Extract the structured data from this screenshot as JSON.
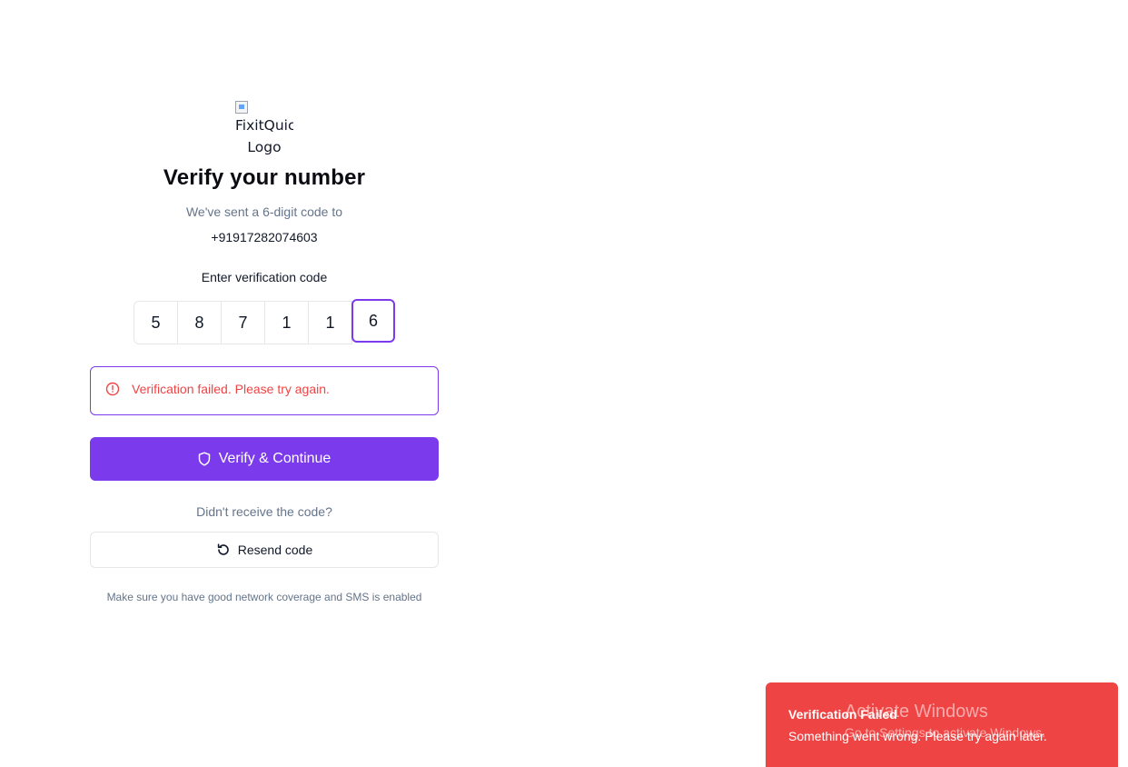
{
  "logo": {
    "alt_text": "FixitQuick Logo"
  },
  "heading": {
    "title": "Verify your number",
    "subtitle": "We've sent a 6-digit code to",
    "phone": "+91917282074603"
  },
  "otp": {
    "label": "Enter verification code",
    "digits": [
      "5",
      "8",
      "7",
      "1",
      "1",
      "6"
    ]
  },
  "error": {
    "message": "Verification failed. Please try again."
  },
  "actions": {
    "verify_label": "Verify & Continue",
    "resend_question": "Didn't receive the code?",
    "resend_label": "Resend code"
  },
  "hint": "Make sure you have good network coverage and SMS is enabled",
  "toast": {
    "title": "Verification Failed",
    "body": "Something went wrong. Please try again later."
  },
  "watermark": {
    "line1": "Activate Windows",
    "line2": "Go to Settings to activate Windows."
  },
  "colors": {
    "accent": "#7c3aed",
    "error": "#ef4444",
    "muted": "#64748b"
  }
}
